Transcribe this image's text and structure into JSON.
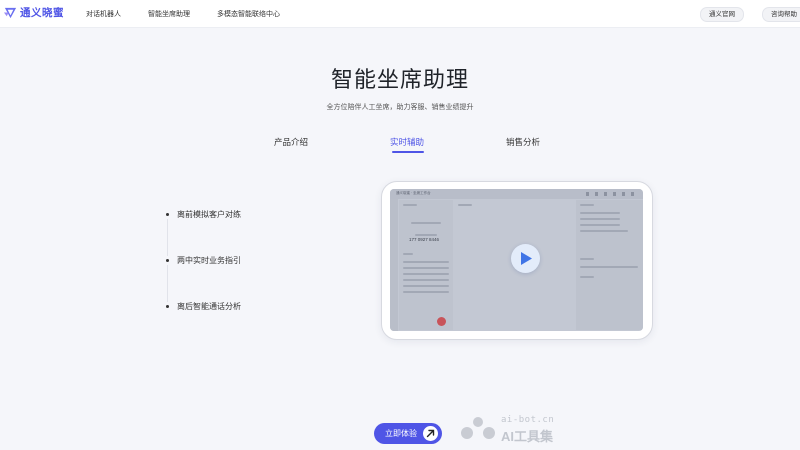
{
  "brand": {
    "name": "通义晓蜜",
    "logo_icon": "tongyi-logo-icon",
    "accent_color": "#4f55e6"
  },
  "nav": {
    "links": [
      "对话机器人",
      "智能坐席助理",
      "多模态智能联络中心"
    ],
    "official_site": "通义官网",
    "consult": "咨询帮助"
  },
  "hero": {
    "title": "智能坐席助理",
    "subtitle": "全方位陪伴人工坐席，助力客服、销售业绩提升"
  },
  "tabs": {
    "items": [
      "产品介绍",
      "实时辅助",
      "销售分析"
    ],
    "active": "实时辅助"
  },
  "features": [
    "离前模拟客户对练",
    "两中实时业务指引",
    "离后智能通话分析"
  ],
  "video": {
    "play_icon": "play-icon",
    "screen_title": "通义晓蜜 · 坐席工作台",
    "phone_number": "177 0927 8446"
  },
  "cta": {
    "label": "立即体验",
    "icon": "arrow-up-right-icon"
  },
  "watermark": {
    "url": "ai-bot.cn",
    "name": "AI工具集"
  }
}
